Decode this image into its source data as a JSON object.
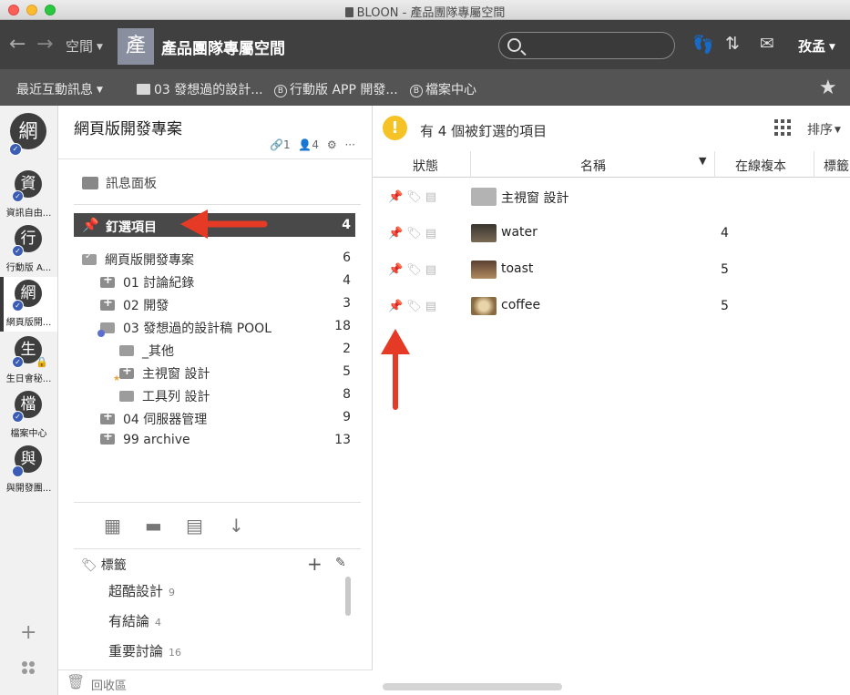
{
  "window": {
    "title": "BLOON - 產品團隊專屬空間"
  },
  "toolbar": {
    "space_label": "空間",
    "avatar_char": "產",
    "space_title": "產品團隊專屬空間",
    "search_placeholder": "",
    "user_name": "孜孟",
    "icons": [
      "back-arrow-icon",
      "forward-arrow-icon",
      "search-icon",
      "footprints-icon",
      "sort-arrows-icon",
      "mail-icon"
    ]
  },
  "bookmarks": {
    "recent_label": "最近互動訊息",
    "items": [
      {
        "label": "03 發想過的設計...",
        "icon": "folder-icon"
      },
      {
        "label": "行動版 APP 開發...",
        "icon": "bloon-badge-icon"
      },
      {
        "label": "檔案中心",
        "icon": "bloon-badge-icon"
      }
    ]
  },
  "spaces": [
    {
      "char": "網",
      "label": "",
      "big": true
    },
    {
      "char": "資",
      "label": "資訊自由..."
    },
    {
      "char": "行",
      "label": "行動版 A..."
    },
    {
      "char": "網",
      "label": "網頁版開...",
      "active": true
    },
    {
      "char": "生",
      "label": "生日會秘...",
      "locked": true
    },
    {
      "char": "檔",
      "label": "檔案中心"
    },
    {
      "char": "與",
      "label": "與開發團..."
    }
  ],
  "project": {
    "title": "網頁版開發專案",
    "link_count": "1",
    "member_count": "4",
    "board_label": "訊息面板",
    "pinned_label": "釘選項目",
    "pinned_count": "4",
    "tree": [
      {
        "label": "網頁版開發專案",
        "count": "6"
      },
      {
        "label": "01 討論紀錄",
        "count": "4"
      },
      {
        "label": "02 開發",
        "count": "3"
      },
      {
        "label": "03 發想過的設計稿 POOL",
        "count": "18"
      },
      {
        "label": "_其他",
        "count": "2"
      },
      {
        "label": "主視窗 設計",
        "count": "5"
      },
      {
        "label": "工具列 設計",
        "count": "8"
      },
      {
        "label": "04 伺服器管理",
        "count": "9"
      },
      {
        "label": "99 archive",
        "count": "13"
      }
    ],
    "tags_label": "標籤",
    "tags": [
      {
        "name": "超酷設計",
        "count": "9"
      },
      {
        "name": "有結論",
        "count": "4"
      },
      {
        "name": "重要討論",
        "count": "16"
      }
    ],
    "trash_label": "回收區"
  },
  "content": {
    "message": "有 4 個被釘選的項目",
    "sort_label": "排序",
    "columns": {
      "status": "狀態",
      "name": "名稱",
      "online": "在線複本",
      "tags": "標籤"
    },
    "rows": [
      {
        "name": "主視窗 設計",
        "copies": "",
        "thumb": "folder"
      },
      {
        "name": "water",
        "copies": "4",
        "thumb": "#5a4a3a"
      },
      {
        "name": "toast",
        "copies": "5",
        "thumb": "#8a6a4a"
      },
      {
        "name": "coffee",
        "copies": "5",
        "thumb": "#c9a66b"
      }
    ]
  },
  "colors": {
    "accent_orange": "#f0a03a",
    "toolbar_dark": "#404040",
    "bookmark_bar": "#545454",
    "selected_row": "#494949",
    "alert_yellow": "#f5c325",
    "annotation_red": "#e53a26"
  }
}
